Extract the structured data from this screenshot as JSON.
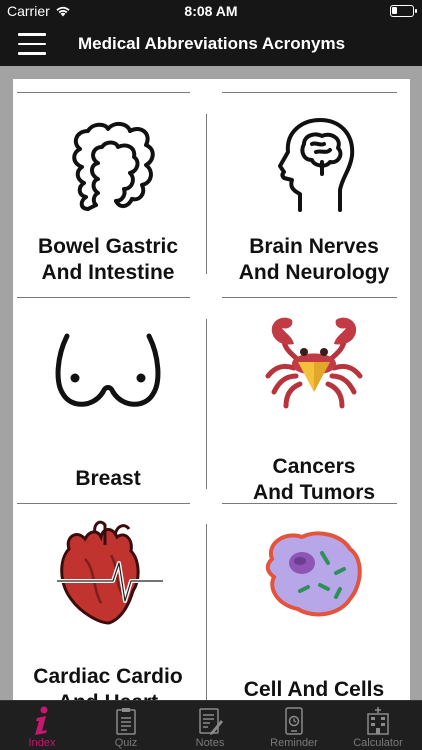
{
  "status": {
    "carrier": "Carrier",
    "time": "8:08 AM"
  },
  "nav": {
    "title": "Medical Abbreviations Acronyms"
  },
  "categories": [
    {
      "line1": "Bowel Gastric",
      "line2": "And Intestine",
      "icon": "intestine-icon"
    },
    {
      "line1": "Brain Nerves",
      "line2": "And Neurology",
      "icon": "head-brain-icon"
    },
    {
      "line1": "Breast",
      "line2": "",
      "icon": "breast-icon"
    },
    {
      "line1": "Cancers",
      "line2": "And Tumors",
      "icon": "crab-icon"
    },
    {
      "line1": "Cardiac Cardio",
      "line2": "And Heart",
      "icon": "heart-ecg-icon"
    },
    {
      "line1": "Cell And Cells",
      "line2": "",
      "icon": "cell-icon"
    }
  ],
  "tabs": [
    {
      "label": "Index",
      "icon": "info-icon",
      "active": true
    },
    {
      "label": "Quiz",
      "icon": "clipboard-icon",
      "active": false
    },
    {
      "label": "Notes",
      "icon": "notes-icon",
      "active": false
    },
    {
      "label": "Reminder",
      "icon": "phone-alarm-icon",
      "active": false
    },
    {
      "label": "Calculator",
      "icon": "calculator-building-icon",
      "active": false
    }
  ],
  "colors": {
    "accent": "#c8176e",
    "bar": "#161616",
    "background": "#a3a3a3"
  }
}
